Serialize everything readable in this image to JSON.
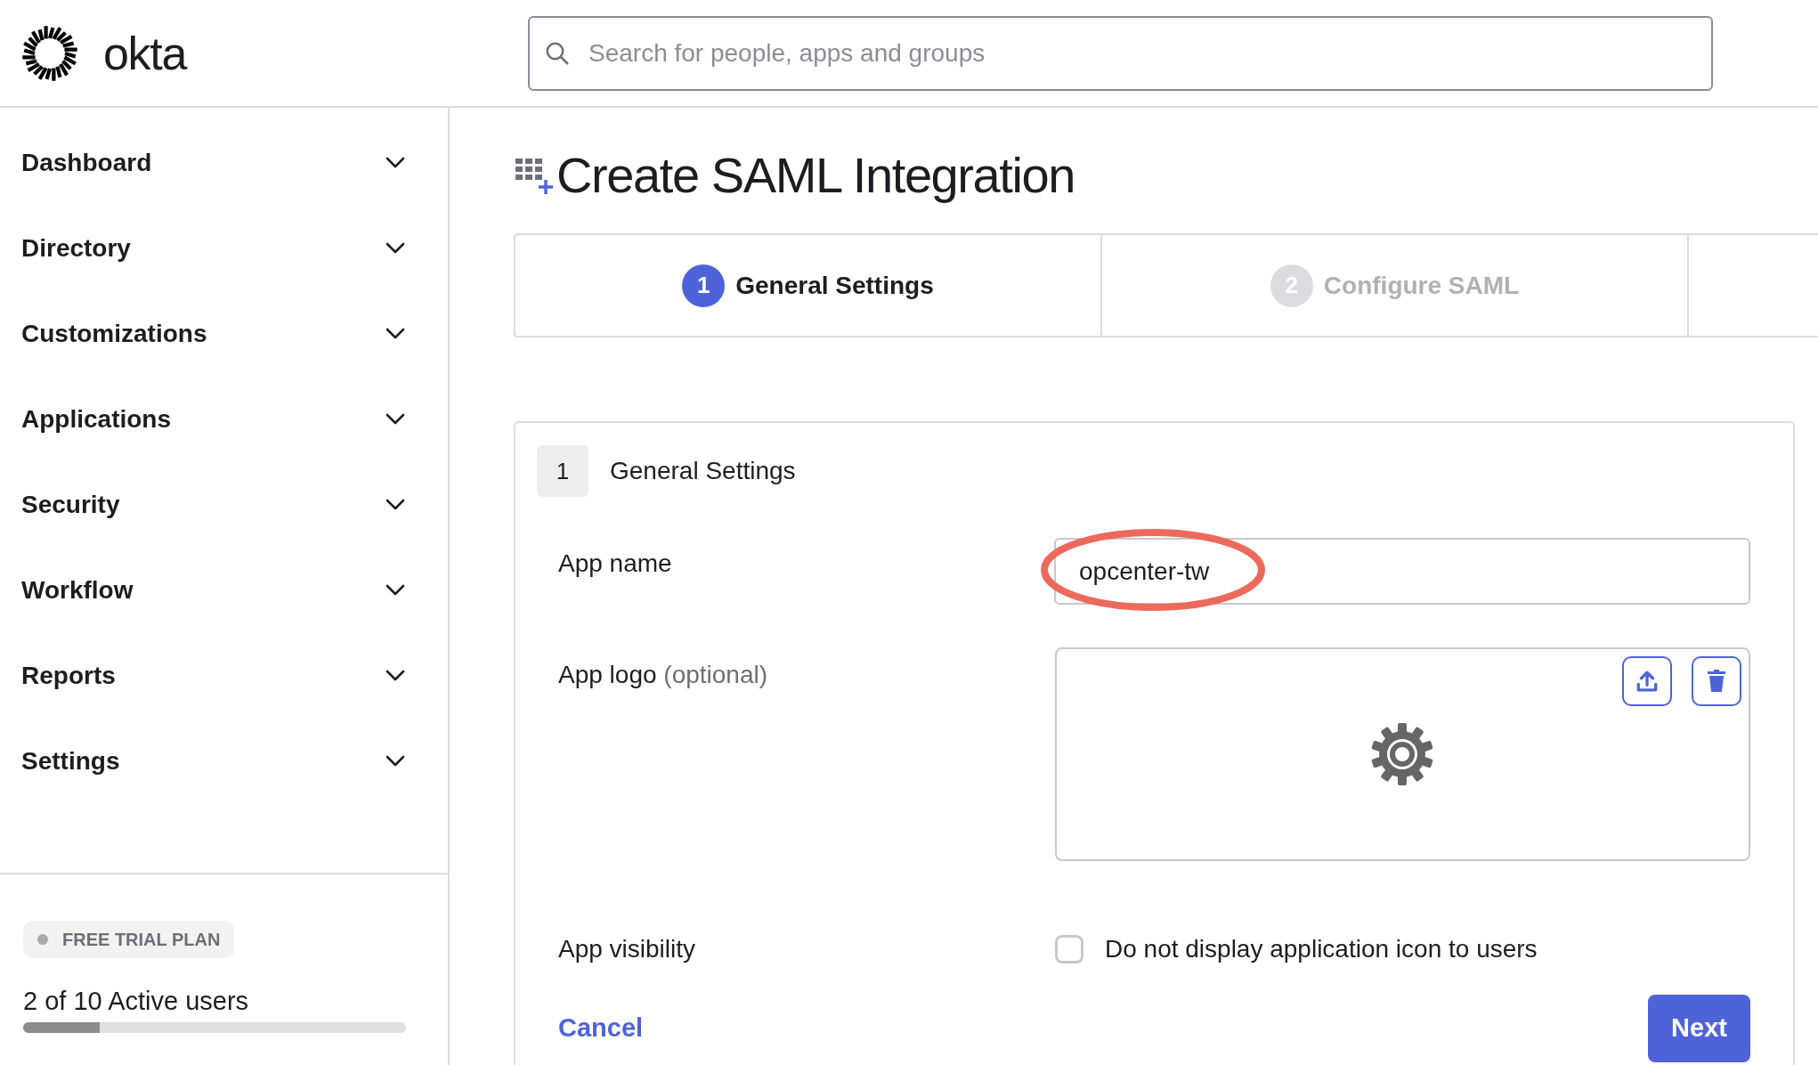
{
  "header": {
    "logo_text": "okta",
    "search": {
      "placeholder": "Search for people, apps and groups"
    }
  },
  "sidebar": {
    "items": [
      {
        "label": "Dashboard",
        "expanded": false
      },
      {
        "label": "Directory",
        "expanded": false
      },
      {
        "label": "Customizations",
        "expanded": false
      },
      {
        "label": "Applications",
        "expanded": false
      },
      {
        "label": "Security",
        "expanded": false
      },
      {
        "label": "Workflow",
        "expanded": false
      },
      {
        "label": "Reports",
        "expanded": false
      },
      {
        "label": "Settings",
        "expanded": false
      }
    ],
    "plan_badge": "FREE TRIAL PLAN",
    "users_text": "2 of 10 Active users",
    "users_level": {
      "level": 0.2
    }
  },
  "page": {
    "title": "Create SAML Integration",
    "steps": [
      {
        "number": "1",
        "label": "General Settings",
        "selected": true
      },
      {
        "number": "2",
        "label": "Configure SAML",
        "selected": false
      }
    ],
    "card": {
      "step_number": "1",
      "title": "General Settings",
      "app_name": {
        "label": "App name",
        "value": "opcenter-tw",
        "highlighted": true
      },
      "app_logo": {
        "label": "App logo",
        "hint": "(optional)"
      },
      "app_visibility": {
        "label": "App visibility",
        "checkbox_label": "Do not display application icon to users",
        "checked": false
      },
      "cancel": "Cancel",
      "next": "Next"
    }
  }
}
